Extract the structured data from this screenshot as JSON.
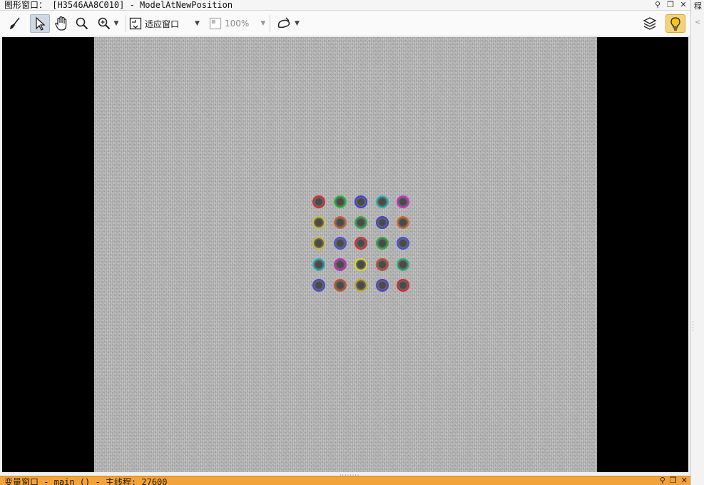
{
  "window": {
    "title": "图形窗口： [H3546AA8C010] - ModelAtNewPosition",
    "controls": {
      "pin": "⚲",
      "float": "❐",
      "close": "✕"
    }
  },
  "toolbar": {
    "clear_icon": "broom-icon",
    "select_icon": "arrow-pointer-icon",
    "pan_icon": "hand-icon",
    "magnify_icon": "magnifier-icon",
    "zoom_icon": "zoom-in-icon",
    "fit_label": "适应窗口",
    "zoom_value": "100%",
    "draw_icon": "shape-draw-icon",
    "layers_icon": "layers-icon",
    "bulb_icon": "lightbulb-icon"
  },
  "image": {
    "dot_colors": [
      [
        "#e0242a",
        "#22c238",
        "#3b3fe0",
        "#21b8b8",
        "#d02cd0"
      ],
      [
        "#d5c21e",
        "#d6622a",
        "#28b83c",
        "#3842d8",
        "#e06a20"
      ],
      [
        "#cfba20",
        "#4850e0",
        "#e02a2a",
        "#22b83a",
        "#4050e0"
      ],
      [
        "#22b8c8",
        "#c828c8",
        "#e0d820",
        "#d04a2a",
        "#28b87a"
      ],
      [
        "#4848d8",
        "#d0522a",
        "#c8a820",
        "#4a40d8",
        "#e0242a"
      ]
    ]
  },
  "bottom_panel": {
    "title": "变量窗口 - main () - 主线程: 27600",
    "controls": {
      "pin": "⚲",
      "float": "❐",
      "close": "✕"
    }
  },
  "side_panel": {
    "label": "程",
    "arrow": "<"
  }
}
